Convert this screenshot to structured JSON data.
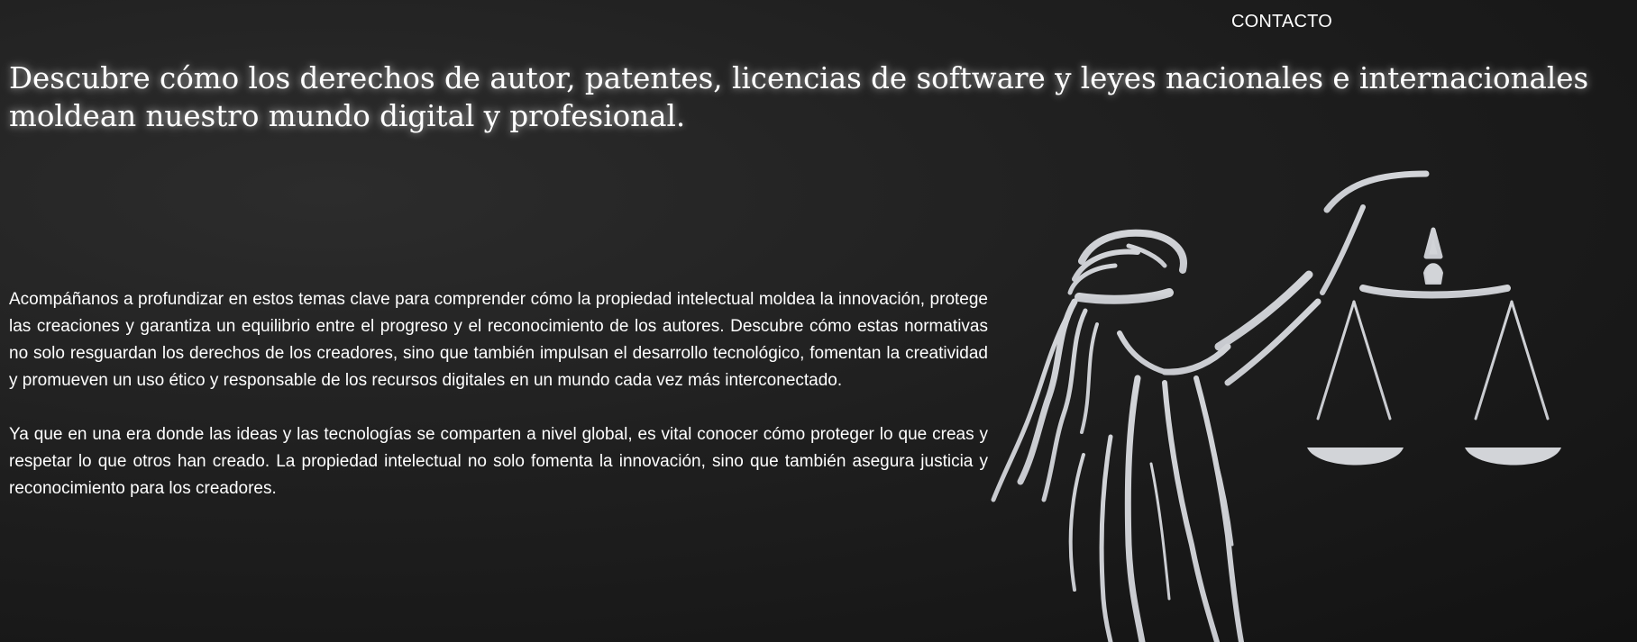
{
  "nav": {
    "contact_label": "CONTACTO"
  },
  "hero": {
    "headline": "Descubre cómo los derechos de autor, patentes, licencias de software y leyes nacionales e internacionales moldean nuestro mundo digital y profesional."
  },
  "content": {
    "paragraphs": [
      "Acompáñanos a profundizar en estos temas clave para comprender cómo la propiedad intelectual moldea la innovación, protege las creaciones y garantiza un equilibrio entre el progreso y el reconocimiento de los autores. Descubre cómo estas normativas no solo resguardan los derechos de los creadores, sino que también impulsan el desarrollo tecnológico, fomentan la creatividad y promueven un uso ético y responsable de los recursos digitales en un mundo cada vez más interconectado.",
      "Ya que en una era donde las ideas y las tecnologías se comparten a nivel global, es vital conocer cómo proteger lo que creas y respetar lo que otros han creado. La propiedad intelectual no solo fomenta la innovación, sino que también asegura justicia y reconocimiento para los creadores."
    ]
  },
  "illustration": {
    "icon": "lady-justice-icon"
  },
  "colors": {
    "background": "#1e1e1e",
    "text": "#ffffff",
    "figure": "#d2d4d8"
  }
}
